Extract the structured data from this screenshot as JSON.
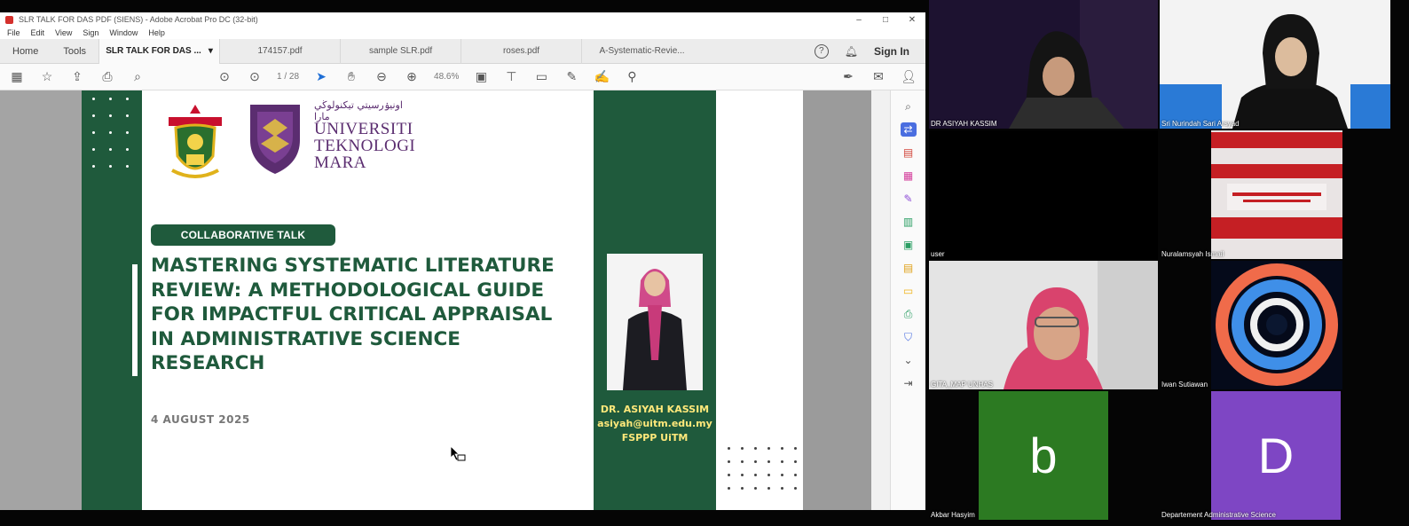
{
  "acrobat": {
    "window_title": "SLR TALK FOR DAS PDF (SIENS) - Adobe Acrobat Pro DC (32-bit)",
    "menu": [
      "File",
      "Edit",
      "View",
      "Sign",
      "Window",
      "Help"
    ],
    "nav_tabs": [
      "Home",
      "Tools"
    ],
    "doc_tabs": [
      {
        "label": "SLR TALK FOR DAS ...",
        "active": true
      },
      {
        "label": "174157.pdf",
        "active": false
      },
      {
        "label": "sample SLR.pdf",
        "active": false
      },
      {
        "label": "roses.pdf",
        "active": false
      },
      {
        "label": "A-Systematic-Revie...",
        "active": false
      }
    ],
    "sign_in": "Sign In",
    "page_indicator": "1 / 28",
    "zoom": "48.6%"
  },
  "slide": {
    "university_arabic": "اونيۏرسيتي تيكنولوڬي مارا",
    "university_line1": "UNIVERSITI",
    "university_line2": "TEKNOLOGI",
    "university_line3": "MARA",
    "badge": "COLLABORATIVE TALK",
    "title": "MASTERING SYSTEMATIC LITERATURE REVIEW: A METHODOLOGICAL GUIDE FOR IMPACTFUL CRITICAL APPRAISAL IN ADMINISTRATIVE SCIENCE RESEARCH",
    "date": "4 AUGUST 2025",
    "speaker_name": "DR. ASIYAH KASSIM",
    "speaker_email": "asiyah@uitm.edu.my",
    "speaker_dept": "FSPPP UiTM",
    "colors": {
      "green": "#1f5a3c",
      "purple": "#5b2d70",
      "yellow": "#ffe87a"
    }
  },
  "participants": [
    {
      "name": "DR ASIYAH KASSIM",
      "type": "video"
    },
    {
      "name": "Sri Nurindah Sari Arsyad",
      "type": "video"
    },
    {
      "name": "user",
      "type": "blank"
    },
    {
      "name": "Nuralamsyah Ismail",
      "type": "video"
    },
    {
      "name": "GITA_MAP UNHAS",
      "type": "video"
    },
    {
      "name": "Iwan Sutiawan",
      "type": "video"
    },
    {
      "name": "Akbar Hasyim",
      "type": "avatar",
      "letter": "b",
      "color": "#2c7a22"
    },
    {
      "name": "Departement Administrative Science",
      "type": "avatar",
      "letter": "D",
      "color": "#7e46c4"
    }
  ]
}
